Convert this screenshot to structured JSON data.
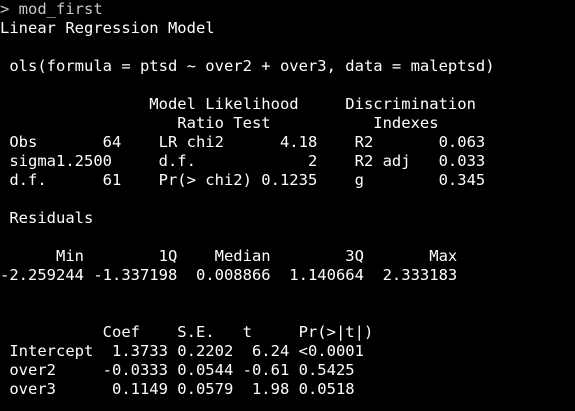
{
  "console": {
    "prompt": "> mod_first",
    "lines": [
      "Linear Regression Model",
      "",
      " ols(formula = ptsd ~ over2 + over3, data = maleptsd)",
      "",
      "                Model Likelihood     Discrimination",
      "                   Ratio Test           Indexes",
      " Obs       64    LR chi2      4.18    R2       0.063",
      " sigma1.2500     d.f.            2    R2 adj   0.033",
      " d.f.      61    Pr(> chi2) 0.1235    g        0.345",
      "",
      " Residuals",
      "",
      "      Min        1Q    Median        3Q       Max",
      "-2.259244 -1.337198  0.008866  1.140664  2.333183",
      "",
      "",
      "           Coef    S.E.   t     Pr(>|t|)",
      " Intercept  1.3733 0.2202  6.24 <0.0001",
      " over2     -0.0333 0.0544 -0.61 0.5425",
      " over3      0.1149 0.0579  1.98 0.0518"
    ]
  },
  "colors": {
    "background": "#000000",
    "text": "#ffffff",
    "prompt": "#c7c7c7"
  }
}
